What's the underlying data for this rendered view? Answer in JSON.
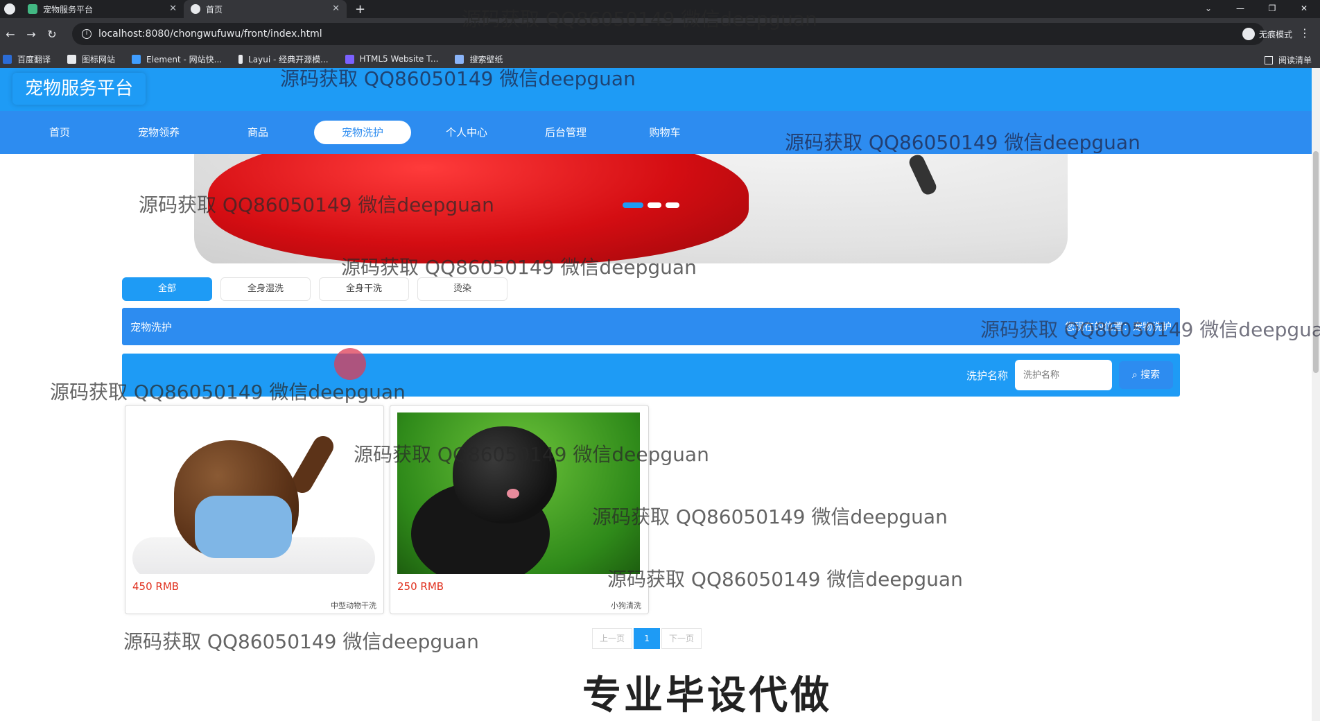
{
  "browser": {
    "tabs": [
      {
        "title": "宠物服务平台",
        "active": false
      },
      {
        "title": "首页",
        "active": true
      }
    ],
    "new_tab_icon": "plus-icon",
    "url": "localhost:8080/chongwufuwu/front/index.html",
    "profile_label": "无痕模式",
    "bookmarks": [
      "百度翻译",
      "图标网站",
      "Element - 网站快...",
      "Layui - 经典开源模...",
      "HTML5 Website T...",
      "搜索壁纸"
    ],
    "reading_list": "阅读清单"
  },
  "site": {
    "logo": "宠物服务平台",
    "nav": [
      "首页",
      "宠物领养",
      "商品",
      "宠物洗护",
      "个人中心",
      "后台管理",
      "购物车"
    ],
    "active_nav": "宠物洗护"
  },
  "filters": {
    "items": [
      "全部",
      "全身湿洗",
      "全身干洗",
      "烫染"
    ],
    "active": "全部"
  },
  "section": {
    "title": "宠物洗护",
    "breadcrumb": "您现在的位置：宠物洗护"
  },
  "search": {
    "label": "洗护名称",
    "placeholder": "洗护名称",
    "button": "搜索"
  },
  "products": [
    {
      "price": "450 RMB",
      "name": "中型动物干洗"
    },
    {
      "price": "250 RMB",
      "name": "小狗清洗"
    }
  ],
  "pagination": {
    "prev": "上一页",
    "current": "1",
    "next": "下一页"
  },
  "promo_text": "专业毕设代做",
  "watermark": "源码获取 QQ86050149 微信deepguan",
  "colors": {
    "header": "#1e9bf5",
    "nav": "#2d8cf0",
    "price": "#e0301e"
  }
}
